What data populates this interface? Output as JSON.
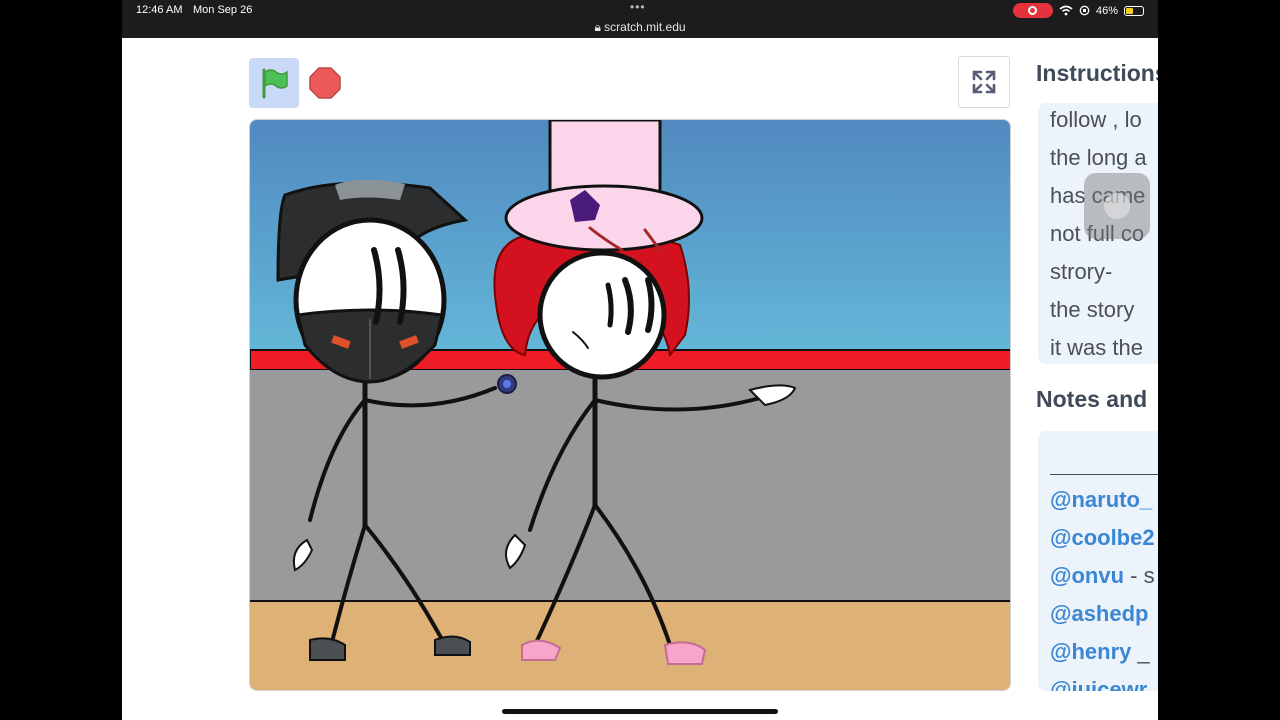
{
  "status_bar": {
    "time": "12:46 AM",
    "date": "Mon Sep 26",
    "url": "scratch.mit.edu",
    "battery": "46%",
    "battery_level": 0.46
  },
  "controls": {
    "green_flag_icon": "green-flag-icon",
    "stop_icon": "stop-sign-icon",
    "fullscreen_icon": "fullscreen-icon"
  },
  "instructions": {
    "heading": "Instructions",
    "lines": [
      "follow , lo",
      "the long a",
      "has came",
      "not full co",
      "strory-",
      "the story",
      "it was the"
    ]
  },
  "notes": {
    "heading": "Notes and",
    "rows": [
      {
        "mention": "@naruto_",
        "rest": ""
      },
      {
        "mention": "@coolbe2",
        "rest": ""
      },
      {
        "mention": "@onvu",
        "rest": " - s"
      },
      {
        "mention": "@ashedp",
        "rest": ""
      },
      {
        "mention": "@henry",
        "rest": " _"
      },
      {
        "mention": "@juicewr",
        "rest": ""
      }
    ]
  },
  "colors": {
    "flag_bg": "#c9daf8",
    "stop": "#e5323b",
    "mention": "#3b87d4",
    "panel_bg": "#edf3fb"
  }
}
